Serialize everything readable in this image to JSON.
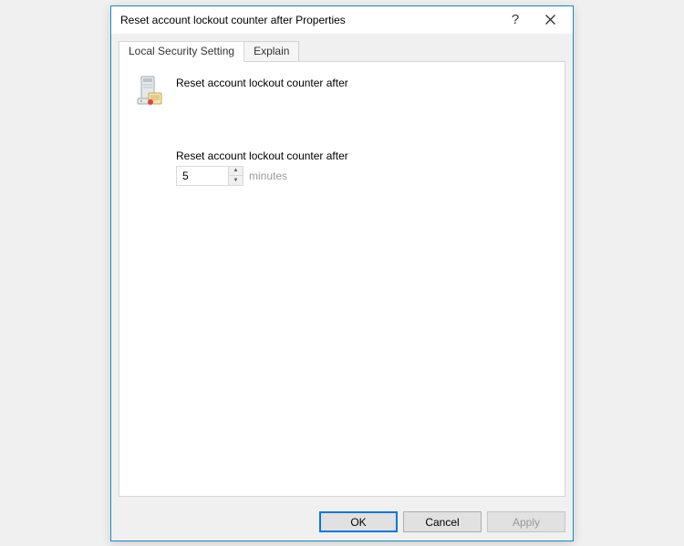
{
  "dialog": {
    "title": "Reset account lockout counter after Properties"
  },
  "tabs": {
    "local": "Local Security Setting",
    "explain": "Explain"
  },
  "policy": {
    "name": "Reset account lockout counter after",
    "settingLabel": "Reset account lockout counter after",
    "value": "5",
    "unit": "minutes"
  },
  "buttons": {
    "ok": "OK",
    "cancel": "Cancel",
    "apply": "Apply"
  }
}
